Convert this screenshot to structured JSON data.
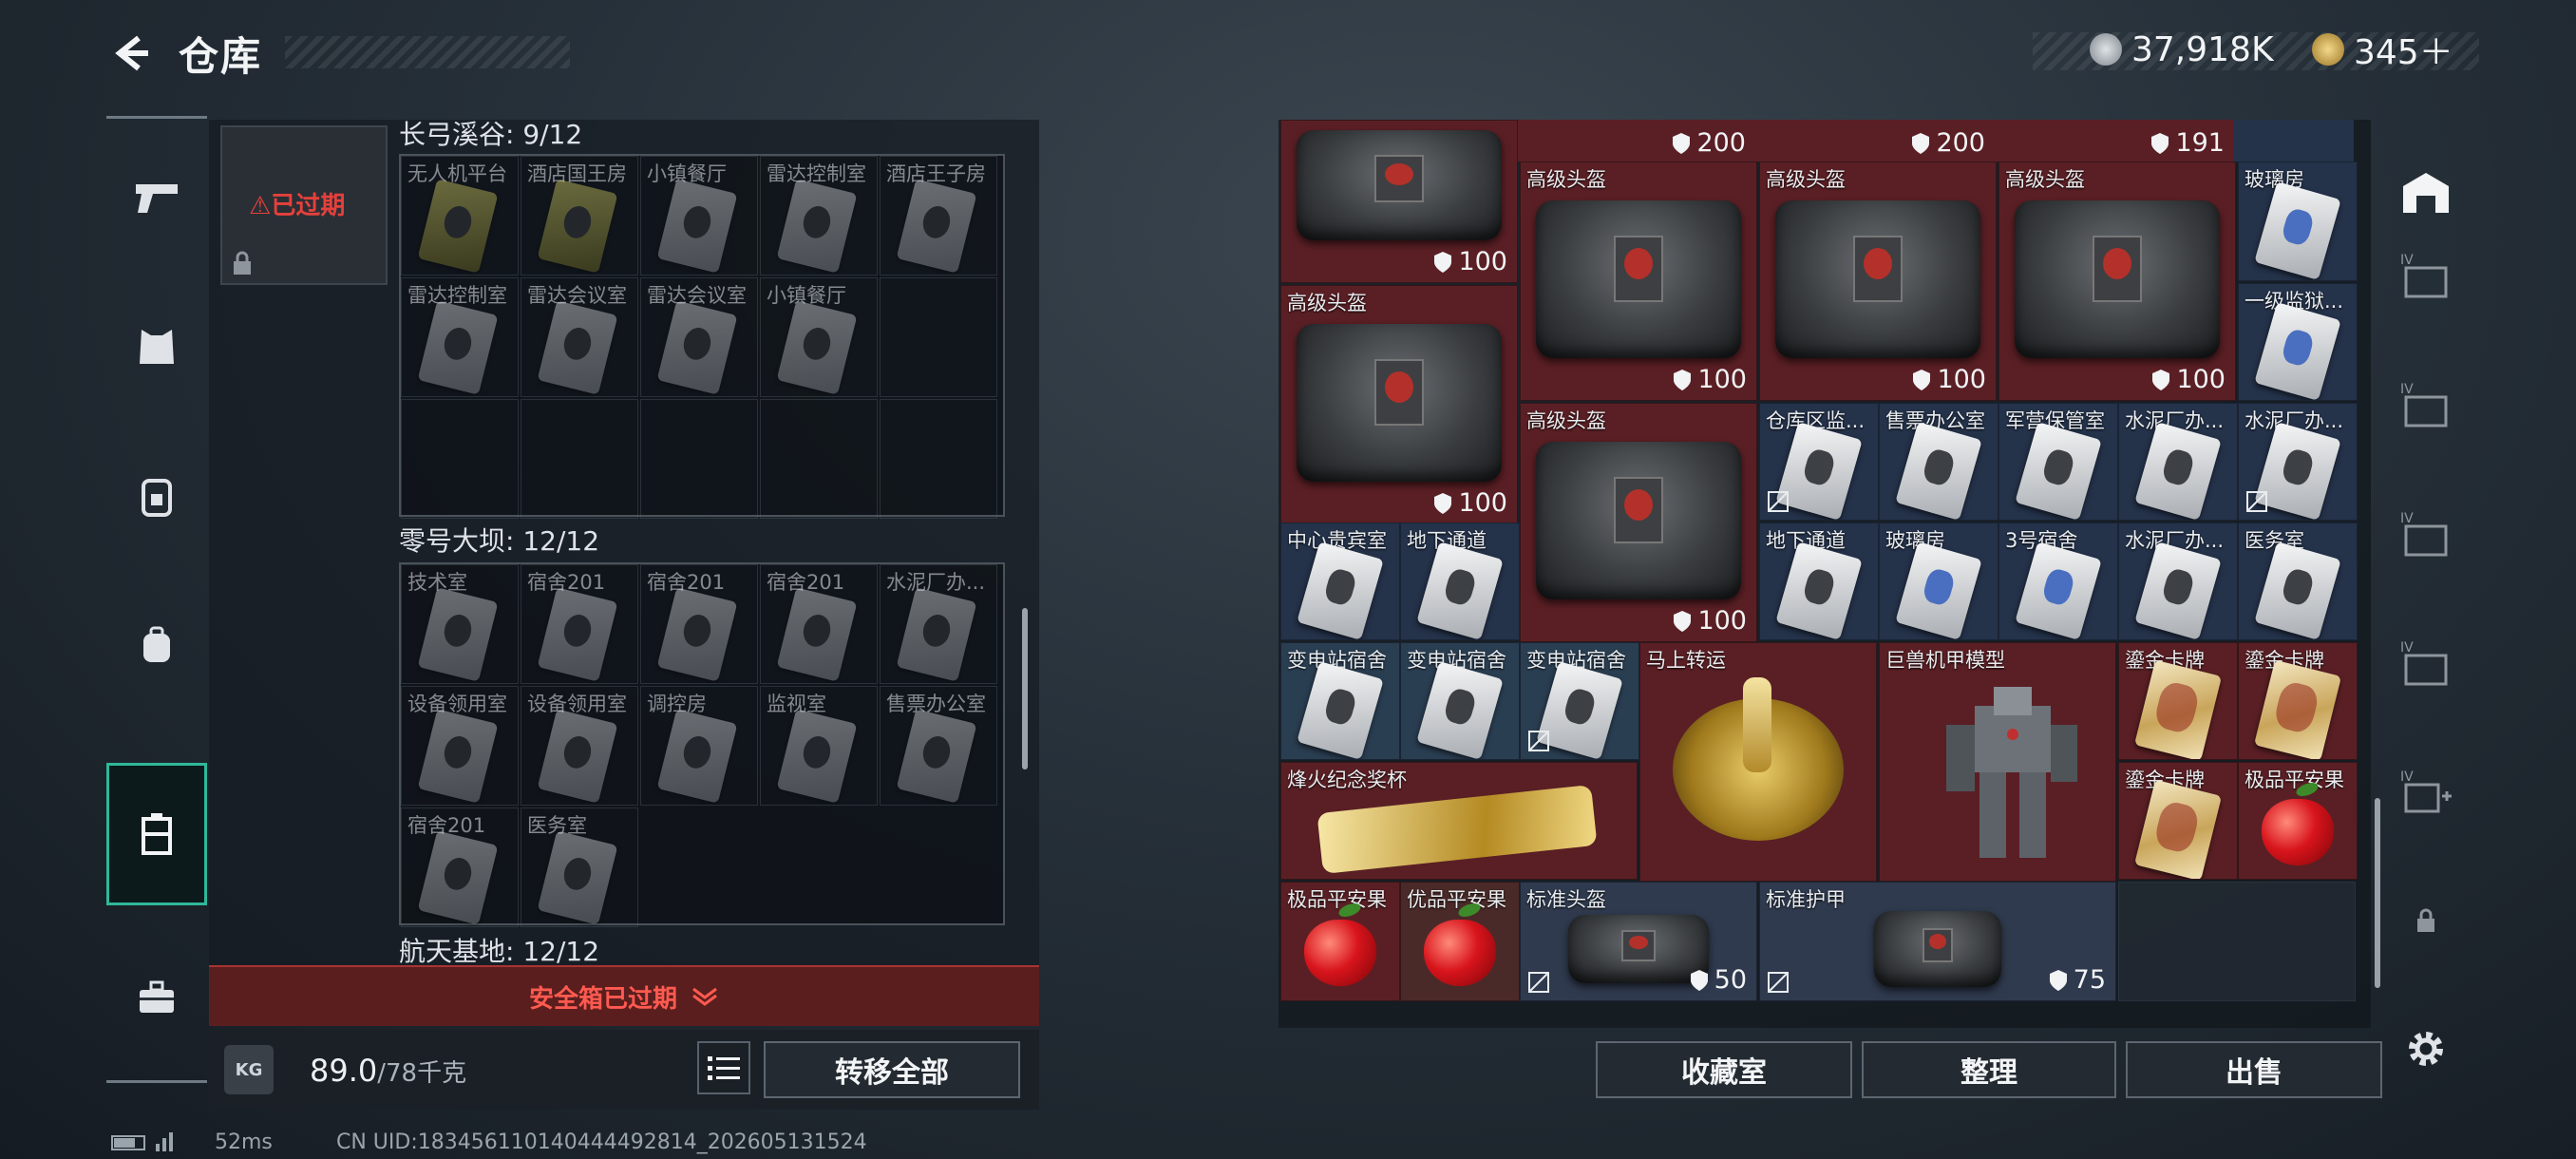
{
  "header": {
    "title": "仓库",
    "currency_primary": "37,918K",
    "currency_secondary": "345＋"
  },
  "left_rail": [
    "weapon-icon",
    "armor-icon",
    "backpack-icon",
    "bag-icon",
    "storage-case-icon",
    "toolbox-icon"
  ],
  "left_panel": {
    "safebox_status": "已过期",
    "sections": [
      {
        "title": "长弓溪谷: 9/12",
        "keys": [
          "无人机平台",
          "酒店国王房",
          "小镇餐厅",
          "雷达控制室",
          "酒店王子房",
          "雷达控制室",
          "雷达会议室",
          "雷达会议室",
          "小镇餐厅"
        ]
      },
      {
        "title": "零号大坝: 12/12",
        "keys": [
          "技术室",
          "宿舍201",
          "宿舍201",
          "宿舍201",
          "水泥厂办...",
          "设备领用室",
          "设备领用室",
          "调控房",
          "监视室",
          "售票办公室",
          "宿舍201",
          "医务室"
        ]
      },
      {
        "title": "航天基地: 12/12",
        "keys": []
      }
    ],
    "expired_bar": "安全箱已过期",
    "weight_value": "89.0",
    "weight_capacity": "/78千克",
    "weight_icon_text": "KG",
    "transfer_all": "转移全部"
  },
  "inventory": {
    "top_durabilities": [
      "200",
      "200",
      "191"
    ],
    "cells": [
      {
        "label": "",
        "type": "bag",
        "durability": "100"
      },
      {
        "label": "高级头盔",
        "type": "bag",
        "durability": "100"
      },
      {
        "label": "高级头盔",
        "type": "bag",
        "durability": "100"
      },
      {
        "label": "高级头盔",
        "type": "bag",
        "durability": "100"
      },
      {
        "label": "高级头盔",
        "type": "bag",
        "durability": "100"
      },
      {
        "label": "高级头盔",
        "type": "bag",
        "durability": "100"
      },
      {
        "label": "玻璃房",
        "type": "keycard"
      },
      {
        "label": "一级监狱...",
        "type": "keycard"
      },
      {
        "label": "仓库区监...",
        "type": "keycard"
      },
      {
        "label": "售票办公室",
        "type": "keycard"
      },
      {
        "label": "军营保管室",
        "type": "keycard"
      },
      {
        "label": "水泥厂办...",
        "type": "keycard"
      },
      {
        "label": "水泥厂办...",
        "type": "keycard"
      },
      {
        "label": "中心贵宾室",
        "type": "keycard"
      },
      {
        "label": "地下通道",
        "type": "keycard"
      },
      {
        "label": "地下通道",
        "type": "keycard"
      },
      {
        "label": "玻璃房",
        "type": "keycard"
      },
      {
        "label": "3号宿舍",
        "type": "keycard"
      },
      {
        "label": "水泥厂办...",
        "type": "keycard"
      },
      {
        "label": "医务室",
        "type": "keycard"
      },
      {
        "label": "变电站宿舍",
        "type": "keycard"
      },
      {
        "label": "变电站宿舍",
        "type": "keycard"
      },
      {
        "label": "变电站宿舍",
        "type": "keycard"
      },
      {
        "label": "马上转运",
        "type": "coin"
      },
      {
        "label": "巨兽机甲模型",
        "type": "mech"
      },
      {
        "label": "鎏金卡牌",
        "type": "goldcard"
      },
      {
        "label": "鎏金卡牌",
        "type": "goldcard"
      },
      {
        "label": "烽火纪念奖杯",
        "type": "trophy"
      },
      {
        "label": "鎏金卡牌",
        "type": "goldcard"
      },
      {
        "label": "极品平安果",
        "type": "apple"
      },
      {
        "label": "极品平安果",
        "type": "apple"
      },
      {
        "label": "优品平安果",
        "type": "apple"
      },
      {
        "label": "标准头盔",
        "type": "bag",
        "durability": "50"
      },
      {
        "label": "标准护甲",
        "type": "vest",
        "durability": "75"
      }
    ],
    "buttons": {
      "collection": "收藏室",
      "organize": "整理",
      "sell": "出售"
    }
  },
  "right_rail": [
    "safe-house-icon",
    "container-iv-icon",
    "container-iv-icon",
    "container-iv-icon",
    "container-iv-icon",
    "container-iv-add-icon",
    "lock-icon",
    "settings-icon"
  ],
  "status_bar": {
    "ping": "52ms",
    "uid": "CN UID:183456110140444492814_202605131524"
  },
  "colors": {
    "accent": "#2fb89a",
    "expired": "#e6403c",
    "cell_red": "#5a1f24",
    "cell_blue": "#24324a"
  }
}
